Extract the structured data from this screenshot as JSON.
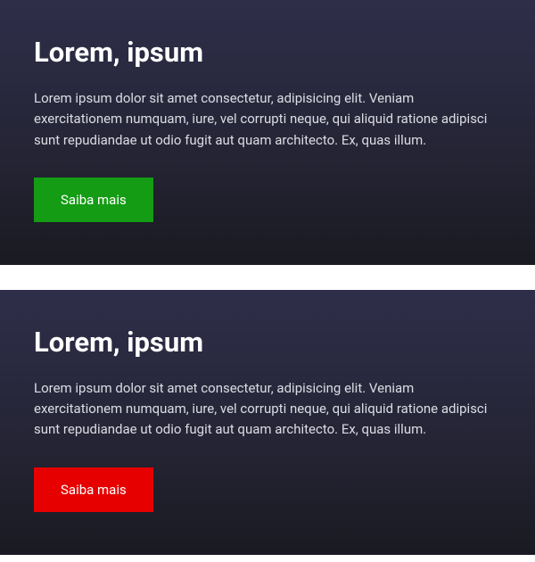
{
  "cards": [
    {
      "title": "Lorem, ipsum",
      "body": "Lorem ipsum dolor sit amet consectetur, adipisicing elit. Veniam exercitationem numquam, iure, vel corrupti neque, qui aliquid ratione adipisci sunt repudiandae ut odio fugit aut quam architecto. Ex, quas illum.",
      "button_label": "Saiba mais"
    },
    {
      "title": "Lorem, ipsum",
      "body": "Lorem ipsum dolor sit amet consectetur, adipisicing elit. Veniam exercitationem numquam, iure, vel corrupti neque, qui aliquid ratione adipisci sunt repudiandae ut odio fugit aut quam architecto. Ex, quas illum.",
      "button_label": "Saiba mais"
    }
  ],
  "colors": {
    "button_green": "#149c14",
    "button_red": "#e60000"
  }
}
